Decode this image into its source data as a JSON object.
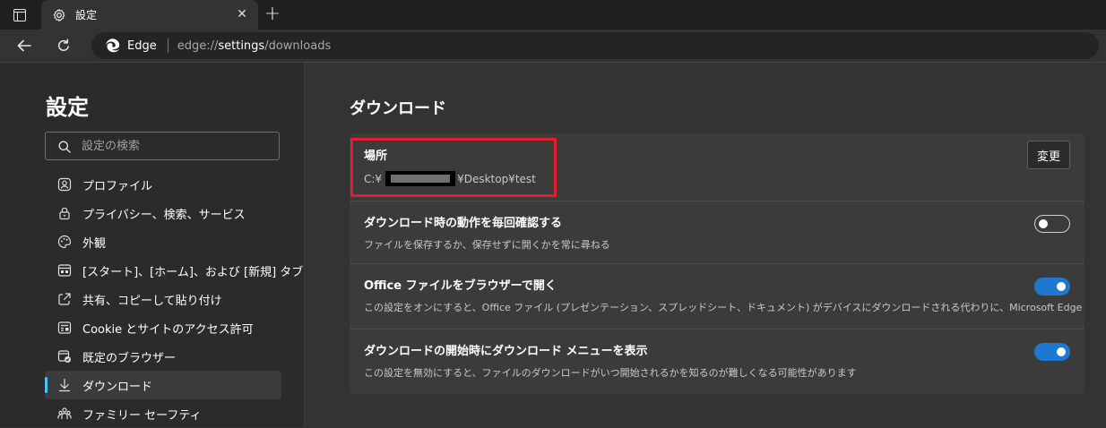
{
  "browser": {
    "tab_title": "設定",
    "site_label": "Edge",
    "url_prefix": "edge://",
    "url_host": "settings",
    "url_path": "/downloads"
  },
  "sidebar": {
    "title": "設定",
    "search_placeholder": "設定の検索",
    "items": [
      {
        "label": "プロファイル",
        "icon": "profile-icon"
      },
      {
        "label": "プライバシー、検索、サービス",
        "icon": "lock-icon"
      },
      {
        "label": "外観",
        "icon": "palette-icon"
      },
      {
        "label": "[スタート]、[ホーム]、および [新規] タブ",
        "icon": "home-grid-icon"
      },
      {
        "label": "共有、コピーして貼り付け",
        "icon": "share-icon"
      },
      {
        "label": "Cookie とサイトのアクセス許可",
        "icon": "site-permissions-icon"
      },
      {
        "label": "既定のブラウザー",
        "icon": "default-browser-icon"
      },
      {
        "label": "ダウンロード",
        "icon": "download-icon",
        "active": true
      },
      {
        "label": "ファミリー セーフティ",
        "icon": "family-icon"
      }
    ]
  },
  "main": {
    "heading": "ダウンロード",
    "location": {
      "title": "場所",
      "path_prefix": "C:¥",
      "path_suffix": "¥Desktop¥test",
      "change_label": "変更"
    },
    "ask_each_time": {
      "title": "ダウンロード時の動作を毎回確認する",
      "description": "ファイルを保存するか、保存せずに開くかを常に尋ねる",
      "enabled": false
    },
    "open_office": {
      "title": "Office ファイルをブラウザーで開く",
      "description": "この設定をオンにすると、Office ファイル (プレゼンテーション、スプレッドシート、ドキュメント) がデバイスにダウンロードされる代わりに、Microsoft Edge で自動的に開きます",
      "enabled": true
    },
    "show_menu": {
      "title": "ダウンロードの開始時にダウンロード メニューを表示",
      "description": "この設定を無効にすると、ファイルのダウンロードがいつ開始されるかを知るのが難しくなる可能性があります",
      "enabled": true
    }
  },
  "colors": {
    "accent": "#1e78cf",
    "highlight": "#e0202c"
  }
}
